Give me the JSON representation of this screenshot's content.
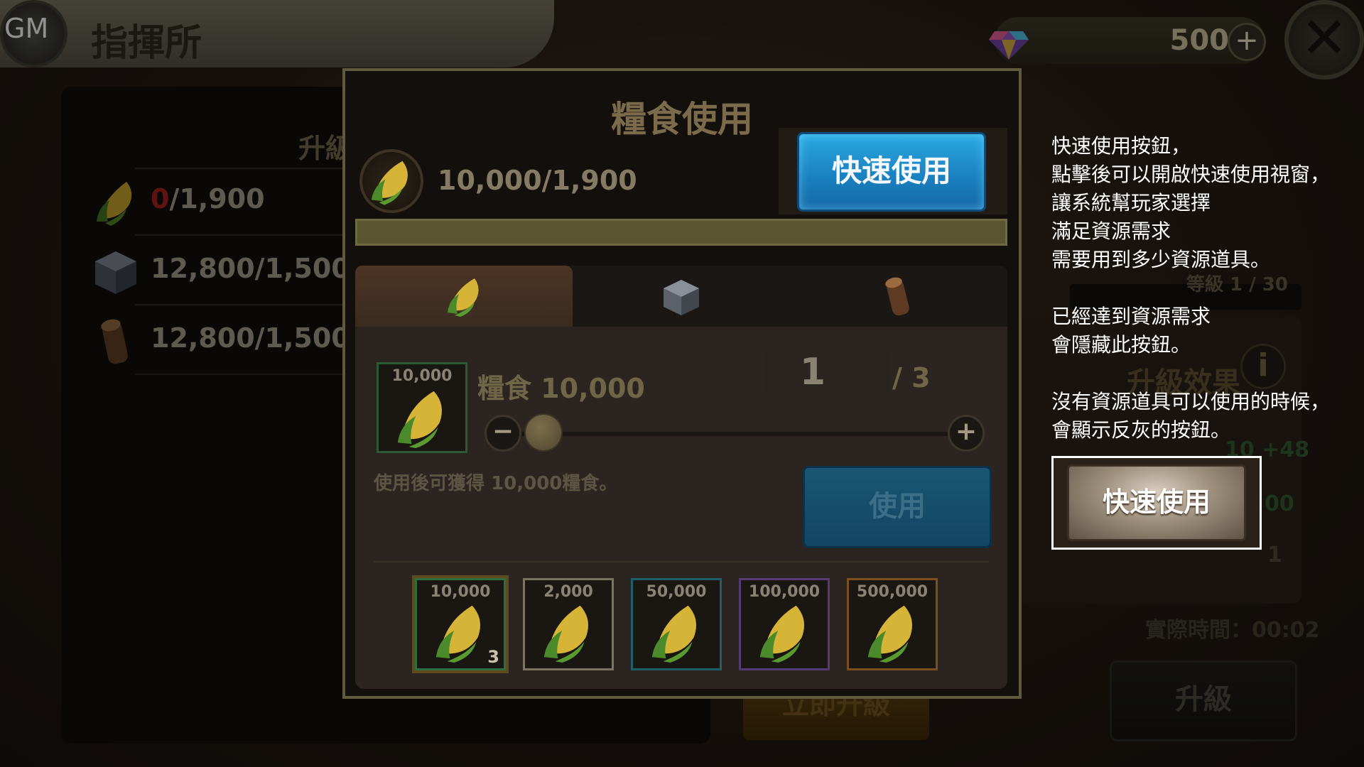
{
  "header": {
    "gm_label": "GM",
    "title": "指揮所",
    "gem_count": "500",
    "gem_plus": "+",
    "close_symbol": "✕"
  },
  "background": {
    "left_header": "升級",
    "requirements": [
      {
        "icon": "corn-icon",
        "have": "0",
        "rest": "/1,900"
      },
      {
        "icon": "stone-icon",
        "have": "",
        "rest": "12,800/1,500"
      },
      {
        "icon": "wood-icon",
        "have": "",
        "rest": "12,800/1,500"
      }
    ],
    "level_text": "等級  1 / 30",
    "effect_title": "升級效果",
    "info_symbol": "i",
    "green_value": "10 +48",
    "green_value2": "00",
    "right_one": "1",
    "actual_time": "實際時間：00:02",
    "upgrade_button": "升級",
    "instant_upgrade_button": "立即升級"
  },
  "modal": {
    "title": "糧食使用",
    "resource_count": "10,000/1,900",
    "quick_use_button": "快速使用",
    "tabs": [
      {
        "icon": "corn-icon",
        "active": true
      },
      {
        "icon": "stone-icon",
        "active": false
      },
      {
        "icon": "wood-icon",
        "active": false
      }
    ],
    "selected_item": {
      "amount": "10,000",
      "name": "糧食 10,000",
      "quantity": "1",
      "max": "/ 3",
      "minus": "−",
      "plus": "+",
      "description": "使用後可獲得 10,000糧食。",
      "use_button": "使用"
    },
    "items": [
      {
        "amount": "10,000",
        "count": "3",
        "rarity": "green"
      },
      {
        "amount": "2,000",
        "count": "",
        "rarity": "gray"
      },
      {
        "amount": "50,000",
        "count": "",
        "rarity": "blue"
      },
      {
        "amount": "100,000",
        "count": "",
        "rarity": "purple"
      },
      {
        "amount": "500,000",
        "count": "",
        "rarity": "orange"
      }
    ]
  },
  "tutorial": {
    "lines_1": [
      "快速使用按鈕，",
      "點擊後可以開啟快速使用視窗，",
      "讓系統幫玩家選擇",
      "滿足資源需求",
      "需要用到多少資源道具。"
    ],
    "lines_2": [
      "已經達到資源需求",
      "會隱藏此按鈕。"
    ],
    "lines_3": [
      "沒有資源道具可以使用的時候，",
      "會顯示反灰的按鈕。"
    ],
    "grayed_button": "快速使用"
  },
  "colors": {
    "quick_use_blue": "#1a82c0",
    "progress_olive": "#595631",
    "shortage_red": "#9b1d1d"
  }
}
